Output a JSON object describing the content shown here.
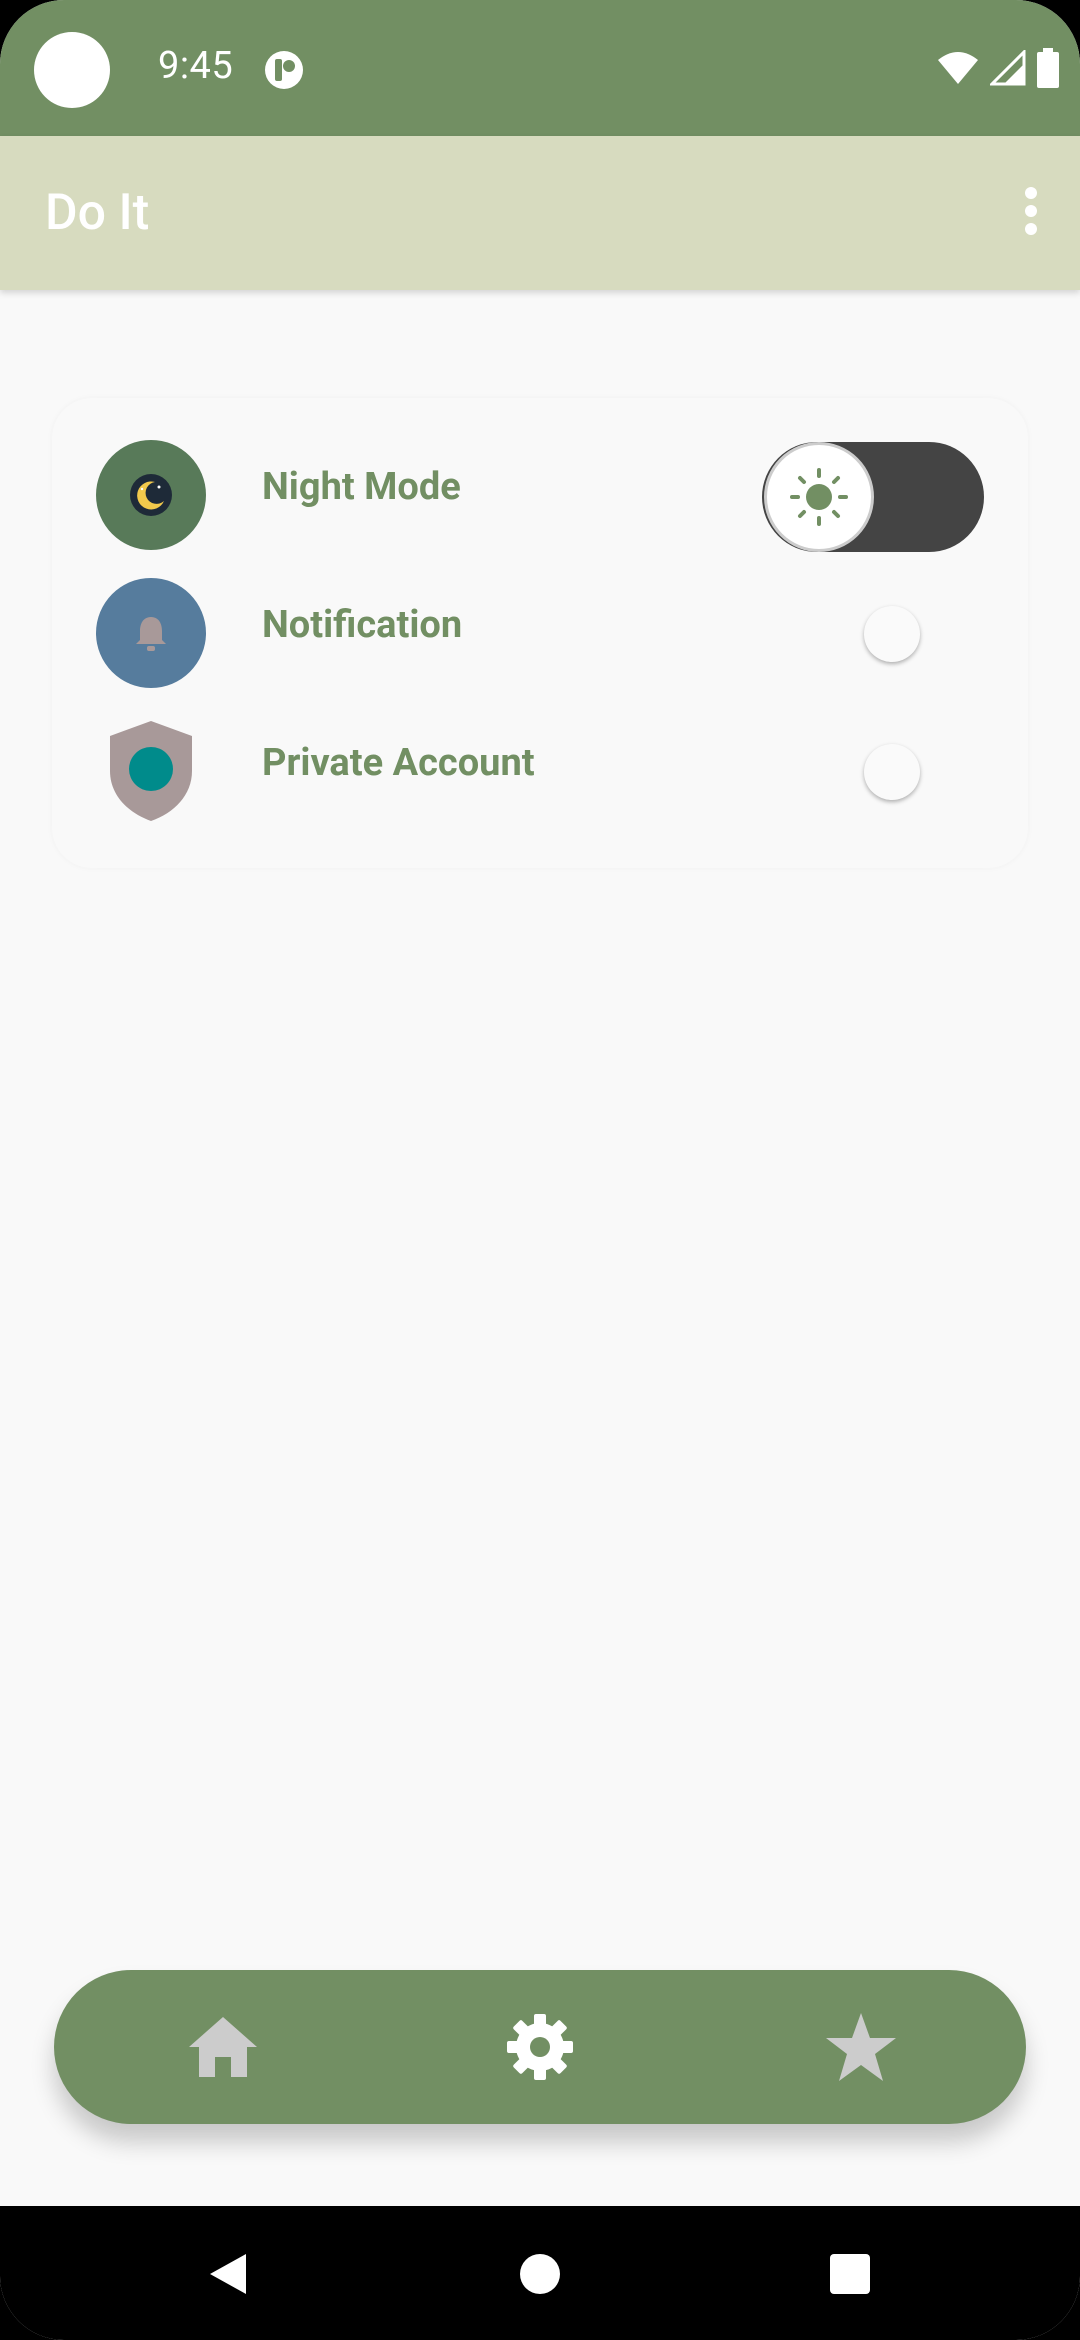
{
  "status_bar": {
    "time": "9:45",
    "icons": [
      "camera-cutout",
      "app-notification-icon",
      "wifi-icon",
      "signal-icon",
      "battery-icon"
    ]
  },
  "app_bar": {
    "title": "Do It",
    "overflow_icon": "more-vert-icon"
  },
  "settings": {
    "items": [
      {
        "label": "Night Mode",
        "icon": "moon-icon",
        "icon_bg": "#587a59",
        "toggle": "thumb-left-sun"
      },
      {
        "label": "Notification",
        "icon": "bell-icon",
        "icon_bg": "#567c9d",
        "toggle": "off"
      },
      {
        "label": "Private Account",
        "icon": "shield-icon",
        "icon_bg": "#a89999",
        "toggle": "off"
      }
    ]
  },
  "bottom_nav": {
    "items": [
      {
        "name": "home",
        "icon": "home-icon"
      },
      {
        "name": "settings",
        "icon": "gear-icon"
      },
      {
        "name": "favorites",
        "icon": "star-icon"
      }
    ],
    "background": "#728f63"
  },
  "colors": {
    "accent": "#728f63",
    "app_bar": "#d7dbbf",
    "background": "#f9f9f9"
  }
}
